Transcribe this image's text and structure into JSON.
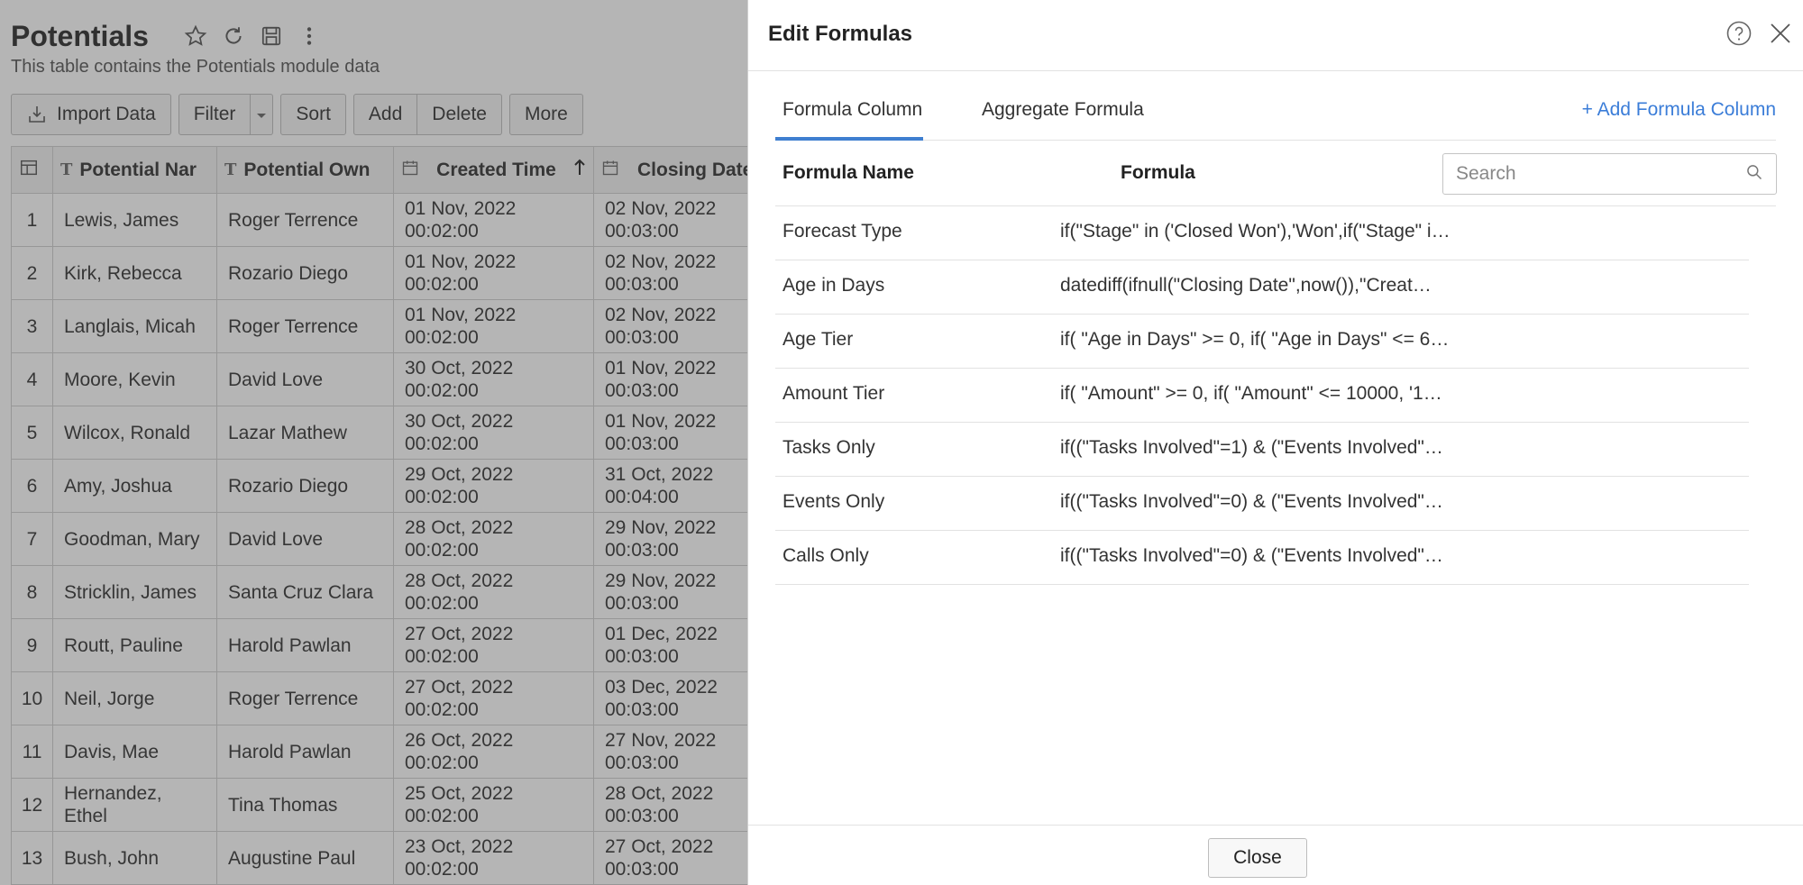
{
  "page": {
    "title": "Potentials",
    "subtitle": "This table contains the Potentials module data",
    "toolbar": {
      "import": "Import Data",
      "filter": "Filter",
      "sort": "Sort",
      "add": "Add",
      "delete": "Delete",
      "more": "More"
    }
  },
  "grid": {
    "columns": [
      "Potential Nar",
      "Potential Own",
      "Created Time",
      "Closing Date"
    ],
    "rows": [
      {
        "n": "1",
        "name": "Lewis, James",
        "owner": "Roger Terrence",
        "created": "01 Nov, 2022\n00:02:00",
        "closing": "02 Nov, 2022\n00:03:00"
      },
      {
        "n": "2",
        "name": "Kirk, Rebecca",
        "owner": "Rozario Diego",
        "created": "01 Nov, 2022\n00:02:00",
        "closing": "02 Nov, 2022\n00:03:00"
      },
      {
        "n": "3",
        "name": "Langlais, Micah",
        "owner": "Roger Terrence",
        "created": "01 Nov, 2022\n00:02:00",
        "closing": "02 Nov, 2022\n00:03:00"
      },
      {
        "n": "4",
        "name": "Moore, Kevin",
        "owner": "David Love",
        "created": "30 Oct, 2022\n00:02:00",
        "closing": "01 Nov, 2022\n00:03:00"
      },
      {
        "n": "5",
        "name": "Wilcox, Ronald",
        "owner": "Lazar Mathew",
        "created": "30 Oct, 2022\n00:02:00",
        "closing": "01 Nov, 2022\n00:03:00"
      },
      {
        "n": "6",
        "name": "Amy, Joshua",
        "owner": "Rozario Diego",
        "created": "29 Oct, 2022\n00:02:00",
        "closing": "31 Oct, 2022\n00:04:00"
      },
      {
        "n": "7",
        "name": "Goodman, Mary",
        "owner": "David Love",
        "created": "28 Oct, 2022\n00:02:00",
        "closing": "29 Nov, 2022\n00:03:00"
      },
      {
        "n": "8",
        "name": "Stricklin, James",
        "owner": "Santa Cruz Clara",
        "created": "28 Oct, 2022\n00:02:00",
        "closing": "29 Nov, 2022\n00:03:00"
      },
      {
        "n": "9",
        "name": "Routt, Pauline",
        "owner": "Harold Pawlan",
        "created": "27 Oct, 2022\n00:02:00",
        "closing": "01 Dec, 2022\n00:03:00"
      },
      {
        "n": "10",
        "name": "Neil, Jorge",
        "owner": "Roger Terrence",
        "created": "27 Oct, 2022\n00:02:00",
        "closing": "03 Dec, 2022\n00:03:00"
      },
      {
        "n": "11",
        "name": "Davis, Mae",
        "owner": "Harold Pawlan",
        "created": "26 Oct, 2022\n00:02:00",
        "closing": "27 Nov, 2022\n00:03:00"
      },
      {
        "n": "12",
        "name": "Hernandez,\nEthel",
        "owner": "Tina Thomas",
        "created": "25 Oct, 2022\n00:02:00",
        "closing": "28 Oct, 2022\n00:03:00"
      },
      {
        "n": "13",
        "name": "Bush, John",
        "owner": "Augustine Paul",
        "created": "23 Oct, 2022\n00:02:00",
        "closing": "27 Oct, 2022\n00:03:00"
      }
    ]
  },
  "drawer": {
    "title": "Edit Formulas",
    "tabs": [
      "Formula Column",
      "Aggregate Formula"
    ],
    "add_link": "+ Add Formula Column",
    "headers": {
      "name": "Formula Name",
      "formula": "Formula"
    },
    "search_placeholder": "Search",
    "formulas": [
      {
        "name": "Forecast Type",
        "expr": "if(\"Stage\" in ('Closed Won'),'Won',if(\"Stage\" i…"
      },
      {
        "name": "Age in Days",
        "expr": "datediff(ifnull(\"Closing Date\",now()),\"Creat…"
      },
      {
        "name": "Age Tier",
        "expr": "if( \"Age in Days\" >= 0, if( \"Age in Days\" <= 6…"
      },
      {
        "name": "Amount Tier",
        "expr": "if( \"Amount\" >= 0, if( \"Amount\" <= 10000, '1…"
      },
      {
        "name": "Tasks Only",
        "expr": "if((\"Tasks Involved\"=1) & (\"Events Involved\"…"
      },
      {
        "name": "Events Only",
        "expr": "if((\"Tasks Involved\"=0) & (\"Events Involved\"…"
      },
      {
        "name": "Calls Only",
        "expr": "if((\"Tasks Involved\"=0) & (\"Events Involved\"…"
      }
    ],
    "close_label": "Close"
  },
  "colors": {
    "accent": "#3f7fd0",
    "link": "#3b7dd8"
  }
}
